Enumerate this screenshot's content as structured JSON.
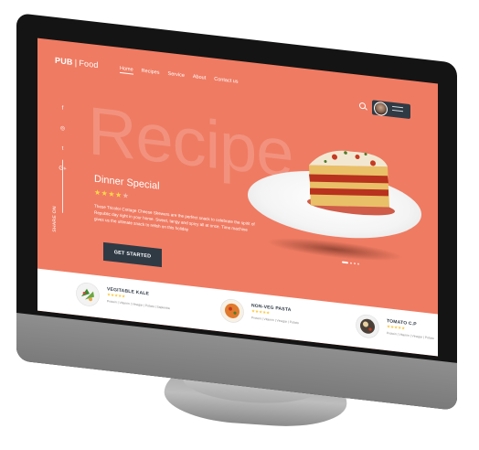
{
  "brand": {
    "part1": "PUB",
    "separator": "|",
    "part2": "Food"
  },
  "nav": {
    "items": [
      "Home",
      "Recipes",
      "Service",
      "About",
      "Contact us"
    ]
  },
  "social": {
    "items": [
      "f",
      "◎",
      "t",
      "G+"
    ],
    "share_label": "SHARE ON"
  },
  "hero": {
    "bg_word": "Recipe",
    "title": "Dinner Special",
    "rating": 4,
    "description": "These Tricolor Cottage Cheese Skewers are the perfect snack to celebrate the spirit of Republic day right in your home. Sweet, tangy and spicy all at once. Time machine gives us the ultimate snack to relish on this holiday",
    "cta_label": "GET STARTED"
  },
  "cards": [
    {
      "name": "VEGITABLE KALE",
      "rating": 5,
      "meta": "Protein | Vitamin | Vinegar | Potato | Sapientia"
    },
    {
      "name": "NON-VEG PASTA",
      "rating": 5,
      "meta": "Protein | Vitamin | Vinegar | Potato"
    },
    {
      "name": "TOMATO C.P",
      "rating": 5,
      "meta": "Protein | Vitamin | Vinegar | Potato"
    }
  ],
  "colors": {
    "accent": "#ef7b62",
    "dark": "#2f3a45",
    "star": "#ffd64a"
  }
}
